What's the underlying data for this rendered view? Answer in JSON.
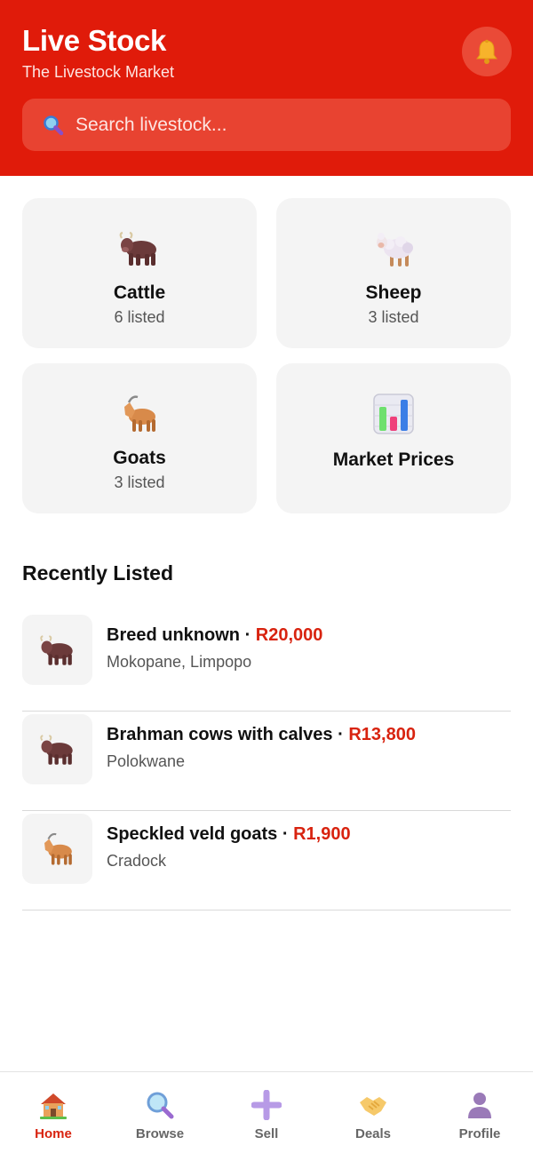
{
  "header": {
    "title": "Live Stock",
    "subtitle": "The Livestock Market",
    "bell_icon": "bell-icon",
    "search_placeholder": "Search livestock...",
    "search_value": "",
    "search_icon": "magnifier-icon",
    "background_color": "#e01b0a"
  },
  "categories": [
    {
      "name": "Cattle",
      "count": "6 listed",
      "icon": "ox-icon"
    },
    {
      "name": "Sheep",
      "count": "3 listed",
      "icon": "sheep-icon"
    },
    {
      "name": "Goats",
      "count": "3 listed",
      "icon": "goat-icon"
    },
    {
      "name": "Market Prices",
      "count": "",
      "icon": "bar-chart-icon"
    }
  ],
  "recent": {
    "title": "Recently Listed",
    "items": [
      {
        "title": "Breed unknown",
        "separator": " · ",
        "price": "R20,000",
        "location": "Mokopane, Limpopo",
        "icon": "ox-icon"
      },
      {
        "title": "Brahman cows with calves",
        "separator": " · ",
        "price": "R13,800",
        "location": "Polokwane",
        "icon": "ox-icon"
      },
      {
        "title": "Speckled veld goats",
        "separator": " · ",
        "price": "R1,900",
        "location": "Cradock",
        "icon": "goat-icon"
      }
    ]
  },
  "nav": [
    {
      "label": "Home",
      "icon": "house-icon",
      "active": true
    },
    {
      "label": "Browse",
      "icon": "magnifier-icon",
      "active": false
    },
    {
      "label": "Sell",
      "icon": "plus-icon",
      "active": false
    },
    {
      "label": "Deals",
      "icon": "handshake-icon",
      "active": false
    },
    {
      "label": "Profile",
      "icon": "person-icon",
      "active": false
    }
  ],
  "colors": {
    "accent": "#e01b0a",
    "price": "#d8230f",
    "card": "#f4f4f4"
  }
}
